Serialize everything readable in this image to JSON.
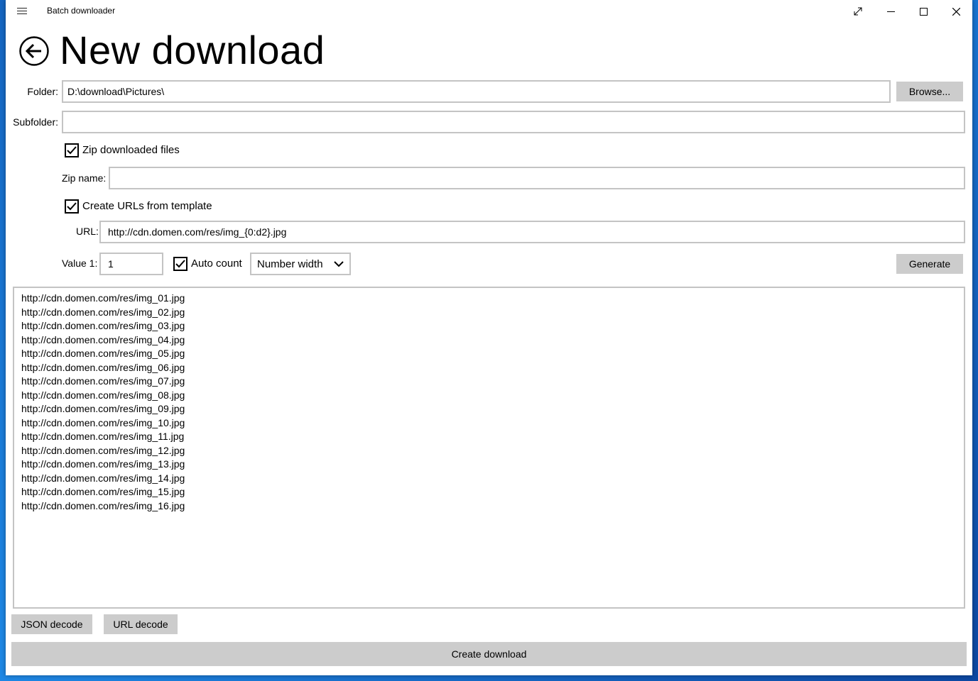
{
  "window": {
    "title": "Batch downloader"
  },
  "page": {
    "title": "New download"
  },
  "form": {
    "folder_label": "Folder:",
    "folder_value": "D:\\download\\Pictures\\",
    "browse_label": "Browse...",
    "subfolder_label": "Subfolder:",
    "subfolder_value": "",
    "zip_checkbox_label": "Zip downloaded files",
    "zip_checked": true,
    "zip_name_label": "Zip name:",
    "zip_name_value": "",
    "template_checkbox_label": "Create URLs from template",
    "template_checked": true,
    "url_label": "URL:",
    "url_value": "http://cdn.domen.com/res/img_{0:d2}.jpg",
    "value1_label": "Value 1:",
    "value1_value": "1",
    "auto_count_label": "Auto count",
    "auto_count_checked": true,
    "number_width_selected": "Number width",
    "generate_label": "Generate"
  },
  "urls": [
    "http://cdn.domen.com/res/img_01.jpg",
    "http://cdn.domen.com/res/img_02.jpg",
    "http://cdn.domen.com/res/img_03.jpg",
    "http://cdn.domen.com/res/img_04.jpg",
    "http://cdn.domen.com/res/img_05.jpg",
    "http://cdn.domen.com/res/img_06.jpg",
    "http://cdn.domen.com/res/img_07.jpg",
    "http://cdn.domen.com/res/img_08.jpg",
    "http://cdn.domen.com/res/img_09.jpg",
    "http://cdn.domen.com/res/img_10.jpg",
    "http://cdn.domen.com/res/img_11.jpg",
    "http://cdn.domen.com/res/img_12.jpg",
    "http://cdn.domen.com/res/img_13.jpg",
    "http://cdn.domen.com/res/img_14.jpg",
    "http://cdn.domen.com/res/img_15.jpg",
    "http://cdn.domen.com/res/img_16.jpg"
  ],
  "actions": {
    "json_decode_label": "JSON decode",
    "url_decode_label": "URL decode",
    "create_download_label": "Create download"
  },
  "icons": {
    "menu": "hamburger-menu-icon",
    "fullscreen": "expand-icon",
    "minimize": "minimize-icon",
    "maximize": "maximize-icon",
    "close": "close-icon",
    "back": "back-arrow-icon",
    "check": "checkmark-icon",
    "dropdown": "chevron-down-icon"
  },
  "colors": {
    "button_bg": "#cccccc",
    "border": "#c4c4c4",
    "desktop": "#1e88e5"
  }
}
